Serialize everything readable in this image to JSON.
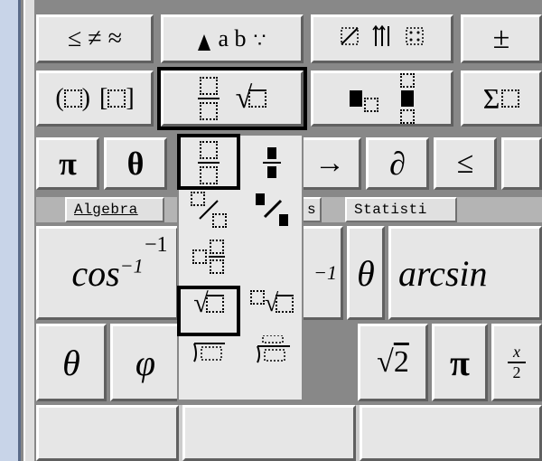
{
  "toolbar_rows": {
    "row1": {
      "relational": "≤ ≠ ≈",
      "spaces": "ạḅ ∵",
      "matrix": "▦ ▥ ▦",
      "plusminus": "±"
    },
    "row2": {
      "fences": "( ) [ ]",
      "fractions": "□/□  √□",
      "dots": "▪ □",
      "sum": "Σ□"
    }
  },
  "symbol_row": {
    "pi": "π",
    "theta": "θ",
    "arrow": "→",
    "partial": "∂",
    "le": "≤"
  },
  "tabs": {
    "algebra": "Algebra",
    "s": "s",
    "statistics": "Statisti"
  },
  "formula_row": {
    "cos_inv": "cos",
    "cos_sup": "−1",
    "arcsin": "arcsin",
    "theta": "θ",
    "sup_minus1": "−1"
  },
  "bottom_row": {
    "theta": "θ",
    "phi": "φ",
    "sqrt2": "√2",
    "pi": "π",
    "half": "x/2"
  },
  "popup": {
    "items": [
      "fraction-dashed",
      "fraction-solid",
      "diag-dashed",
      "diag-solid",
      "mixed-dashed",
      null,
      "sqrt-dashed",
      "nthroot-dashed",
      "longdiv-dashed",
      "longdiv-solid"
    ]
  }
}
